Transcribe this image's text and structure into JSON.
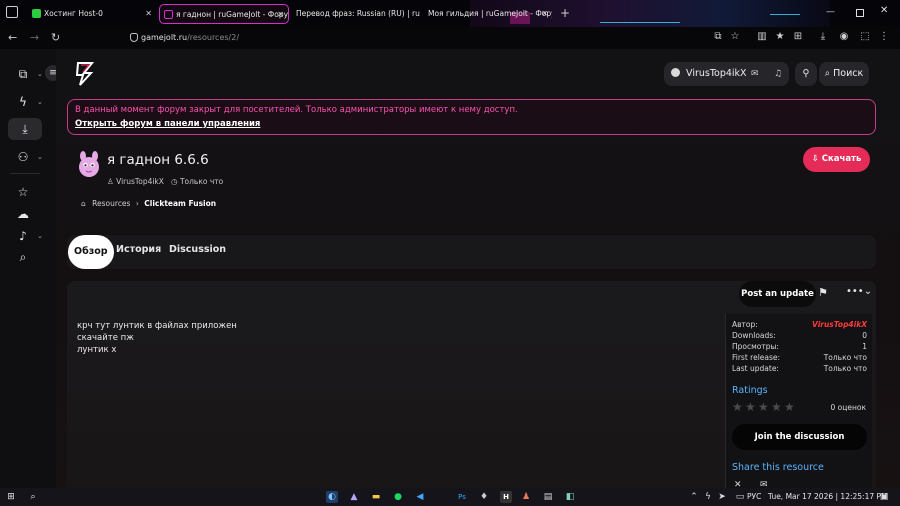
{
  "browser": {
    "tabs": [
      {
        "label": "Хостинг Host-0",
        "fav_color": "#2ecc40"
      },
      {
        "label": "я гаднон | ruGameJolt - Форум",
        "fav_color": "#d32fd0"
      },
      {
        "label": "Перевод фраз: Russian (RU) | ruGa",
        "fav_color": "#777777"
      },
      {
        "label": "Моя гильдия | ruGameJolt - Форум",
        "fav_color": "#777777"
      }
    ],
    "new_tab": "+",
    "url_domain": "gamejolt.ru",
    "url_path": "/resources/2/"
  },
  "header": {
    "user": "VirusTop4ikX",
    "search": "Поиск"
  },
  "alert": {
    "message": "В данный момент форум закрыт для посетителей. Только администраторы имеют к нему доступ.",
    "link": "Открыть форум в панели управления"
  },
  "resource": {
    "title": "я гаднон 6.6.6",
    "author": "VirusTop4ikX",
    "time": "Только что",
    "download": "Скачать",
    "breadcrumb": [
      "Resources",
      "Clickteam Fusion"
    ]
  },
  "tabs": [
    "Обзор",
    "История",
    "Discussion"
  ],
  "panel": {
    "post_update": "Post an update",
    "description": [
      "крч тут лунтик в файлах приложен",
      "скачайте пж",
      "лунтик х"
    ]
  },
  "info": {
    "rows": [
      {
        "label": "Автор:",
        "value": "VirusTop4ikX"
      },
      {
        "label": "Downloads:",
        "value": "0"
      },
      {
        "label": "Просмотры:",
        "value": "1"
      },
      {
        "label": "First release:",
        "value": "Только что"
      },
      {
        "label": "Last update:",
        "value": "Только что"
      }
    ],
    "ratings_title": "Ratings",
    "ratings_count": "0 оценок",
    "join": "Join the discussion",
    "share": "Share this resource"
  },
  "taskbar": {
    "lang": "РУС",
    "clock": "Tue, Mar 17 2026 | 12:25:17 PM"
  },
  "colors": {
    "accent": "#e52b58",
    "alert_border": "#c63c8b",
    "link_blue": "#5ab4ff"
  }
}
